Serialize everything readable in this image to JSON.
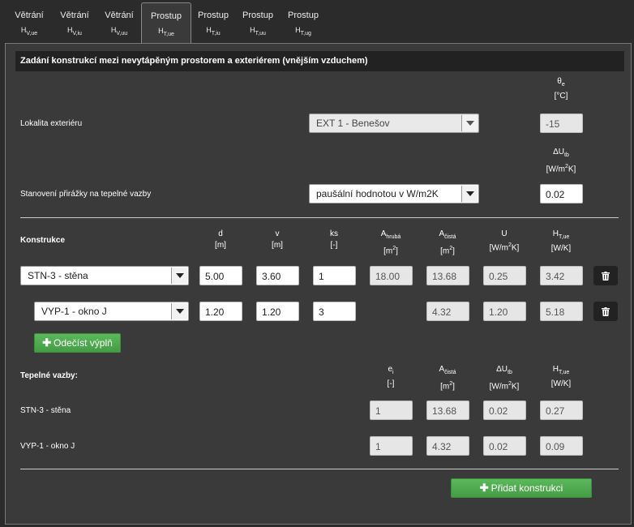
{
  "tabs": [
    {
      "line1": "Větrání",
      "main": "H",
      "sub": "V,ue"
    },
    {
      "line1": "Větrání",
      "main": "H",
      "sub": "V,iu"
    },
    {
      "line1": "Větrání",
      "main": "H",
      "sub": "V,uu"
    },
    {
      "line1": "Prostup",
      "main": "H",
      "sub": "T,ue"
    },
    {
      "line1": "Prostup",
      "main": "H",
      "sub": "T,iu"
    },
    {
      "line1": "Prostup",
      "main": "H",
      "sub": "T,uu"
    },
    {
      "line1": "Prostup",
      "main": "H",
      "sub": "T,ug"
    }
  ],
  "header": "Zadání konstrukcí mezi nevytápěným prostorem a exteriérem (vnějším vzduchem)",
  "theta": {
    "symbol": "θ",
    "sub": "e",
    "unit": "[°C]"
  },
  "dutb": {
    "symbol": "ΔU",
    "sub": "tb",
    "unit_a": "[W/m",
    "unit_sup": "2",
    "unit_b": "K]"
  },
  "lokalita": {
    "label": "Lokalita exteriéru",
    "select": "EXT 1 - Benešov",
    "value": "-15"
  },
  "prirazka": {
    "label": "Stanovení přirážky na tepelné vazby",
    "select": "paušální hodnotou v W/m2K",
    "value": "0.02"
  },
  "konstrukce": {
    "label": "Konstrukce",
    "cols": [
      {
        "a": "d",
        "b": "[m]"
      },
      {
        "a": "v",
        "b": "[m]"
      },
      {
        "a": "ks",
        "b": "[-]"
      },
      {
        "a": "A",
        "sub": "hrubá",
        "b": "[m",
        "sup": "2",
        "c": "]"
      },
      {
        "a": "A",
        "sub": "čistá",
        "b": "[m",
        "sup": "2",
        "c": "]"
      },
      {
        "a": "U",
        "b": "[W/m",
        "sup": "2",
        "c": "K]"
      },
      {
        "a": "H",
        "sub": "T,ue",
        "b": "[W/K]"
      }
    ],
    "row1": {
      "select": "STN-3 - stěna",
      "d": "5.00",
      "v": "3.60",
      "ks": "1",
      "ahruba": "18.00",
      "acista": "13.68",
      "u": "0.25",
      "h": "3.42"
    },
    "row2": {
      "select": "VYP-1 - okno J",
      "d": "1.20",
      "v": "1.20",
      "ks": "3",
      "acista": "4.32",
      "u": "1.20",
      "h": "5.18"
    },
    "odecist": "Odečíst výplň"
  },
  "vazby": {
    "label": "Tepelné vazby:",
    "cols": [
      {
        "a": "e",
        "sub": "i",
        "b": "[-]"
      },
      {
        "a": "A",
        "sub": "čistá",
        "b": "[m",
        "sup": "2",
        "c": "]"
      },
      {
        "a": "ΔU",
        "sub": "tb",
        "b": "[W/m",
        "sup": "2",
        "c": "K]"
      },
      {
        "a": "H",
        "sub": "T,ue",
        "b": "[W/K]"
      }
    ],
    "rows": [
      {
        "name": "STN-3 - stěna",
        "e": "1",
        "a": "13.68",
        "du": "0.02",
        "h": "0.27"
      },
      {
        "name": "VYP-1 - okno J",
        "e": "1",
        "a": "4.32",
        "du": "0.02",
        "h": "0.09"
      }
    ]
  },
  "pridat": "Přidat konstrukci"
}
